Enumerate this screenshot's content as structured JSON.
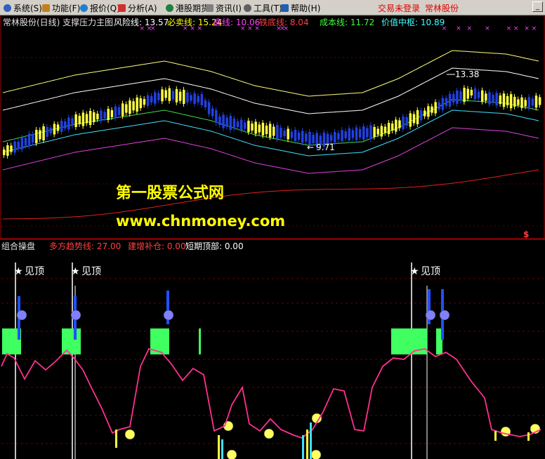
{
  "menu": {
    "items": [
      {
        "label": "系统(S)",
        "icon": "system-icon",
        "color": "#3060c0"
      },
      {
        "label": "功能(F)",
        "icon": "function-icon",
        "color": "#c08020"
      },
      {
        "label": "报价(Q)",
        "icon": "quote-icon",
        "color": "#2080d0"
      },
      {
        "label": "分析(A)",
        "icon": "analysis-icon",
        "color": "#d03030"
      },
      {
        "label": "港股期货",
        "icon": "hk-futures-icon",
        "color": "#208040"
      },
      {
        "label": "资讯(I)",
        "icon": "news-icon",
        "color": "#808080"
      },
      {
        "label": "工具(T)",
        "icon": "tools-icon",
        "color": "#606060"
      },
      {
        "label": "帮助(H)",
        "icon": "help-icon",
        "color": "#2060b0"
      }
    ],
    "trade_status": "交易未登录",
    "stock_name": "常林股份"
  },
  "main_panel": {
    "title": "常林股份(日线) 支撑压力主图",
    "indicators": [
      {
        "label": "风险线:",
        "value": "13.57",
        "color": "#ffffff"
      },
      {
        "label": "必卖线:",
        "value": "15.24",
        "color": "#ffff00"
      },
      {
        "label": "底线:",
        "value": "10.06",
        "color": "#ff40ff"
      },
      {
        "label": "铁底线:",
        "value": "8.04",
        "color": "#ff4040"
      },
      {
        "label": "成本线:",
        "value": "11.72",
        "color": "#40ff40"
      },
      {
        "label": "价值中枢:",
        "value": "10.89",
        "color": "#40ffff"
      }
    ],
    "high_label": "13.38",
    "low_label": "9.71",
    "watermark_title": "第一股票公式网",
    "watermark_url": "www.chnmoney.com",
    "dollar_icon": "$"
  },
  "sub_panel": {
    "title": "组合操盘",
    "indicators": [
      {
        "label": "多方趋势线:",
        "value": "27.00",
        "color": "#ff4040"
      },
      {
        "label": "建增补仓:",
        "value": "0.00",
        "color": "#ff4040"
      },
      {
        "label": "短期顶部:",
        "value": "0.00",
        "color": "#ffffff"
      }
    ],
    "top_signal_label": "见顶"
  },
  "colors": {
    "up_candle": "#ffff40",
    "down_candle": "#2040e0",
    "risk": "#ffffff",
    "sell": "#ffff60",
    "bottom": "#e040e0",
    "iron_bottom": "#e02020",
    "cost": "#40e040",
    "value": "#40e0ff",
    "trend": "#ff3090",
    "signal_green": "#40ff60",
    "signal_blue": "#2050ff"
  }
}
